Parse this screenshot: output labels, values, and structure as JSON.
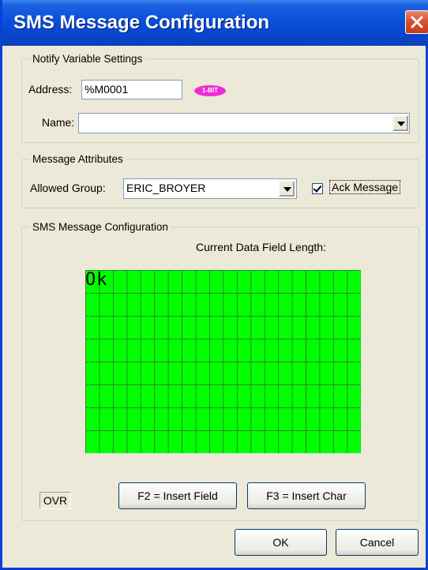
{
  "window": {
    "title": "SMS Message Configuration"
  },
  "notify": {
    "legend": "Notify Variable Settings",
    "address_label": "Address:",
    "address_value": "%M0001",
    "bit_badge": "1-BIT",
    "name_label": "Name:",
    "name_value": ""
  },
  "attributes": {
    "legend": "Message Attributes",
    "group_label": "Allowed Group:",
    "group_value": "ERIC_BROYER",
    "ack_label": "Ack Message",
    "ack_checked": true
  },
  "sms": {
    "legend": "SMS Message Configuration",
    "length_label": "Current Data Field Length:",
    "message_text": "Ok",
    "grid_color": "#00ff00",
    "ovr_label": "OVR",
    "insert_field_label": "F2 = Insert Field",
    "insert_char_label": "F3 = Insert Char"
  },
  "footer": {
    "ok_label": "OK",
    "cancel_label": "Cancel"
  },
  "colors": {
    "titlebar": "#0a50da",
    "badge": "#ee2bd6",
    "close": "#d8542c"
  }
}
